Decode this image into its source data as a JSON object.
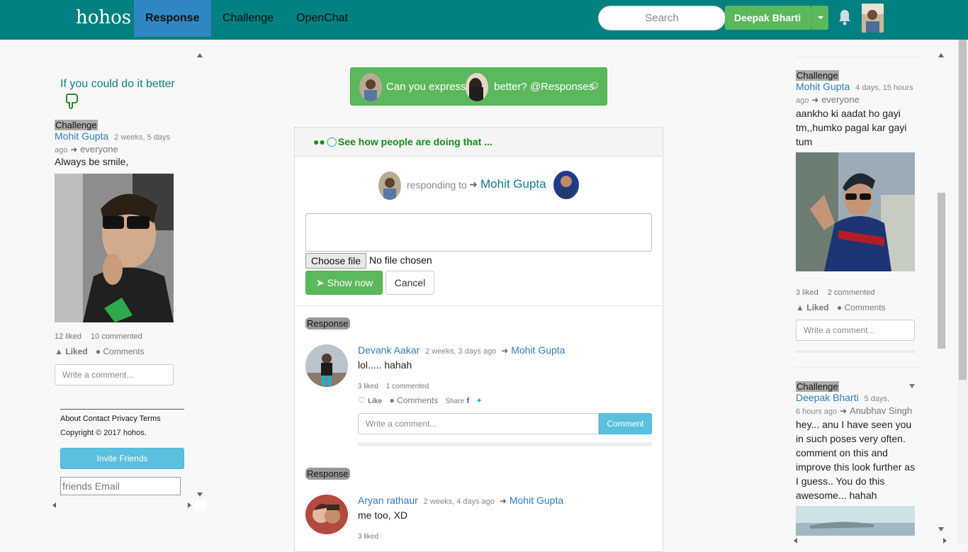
{
  "nav": {
    "brand": "hohos",
    "tabs": [
      "Response",
      "Challenge",
      "OpenChat"
    ],
    "search_placeholder": "Search",
    "user_name": "Deepak Bharti"
  },
  "left": {
    "promo": "If you could do it better",
    "post": {
      "tag": "Challenge",
      "author": "Mohit Gupta",
      "time_line1": "2 weeks, 5 days",
      "time_line2": "ago",
      "audience": "everyone",
      "text": "Always be smile,",
      "liked_count": "12 liked",
      "commented_count": "10 commented",
      "liked_label": "Liked",
      "comments_label": "Comments",
      "comment_placeholder": "Write a comment..."
    },
    "footer_links": "About Contact Privacy Terms",
    "copyright": "Copyright © 2017 hohos.",
    "invite_label": "Invite Friends",
    "email_placeholder": "friends Email"
  },
  "center": {
    "express_before": "Can you express",
    "express_after": "better? @Responses",
    "see_how": "See how people are doing that ...",
    "responding_to": "responding to",
    "responding_name": "Mohit Gupta",
    "file_button": "Choose file",
    "file_status": "No file chosen",
    "show_now": "Show now",
    "cancel": "Cancel",
    "responses": [
      {
        "tag": "Response",
        "author": "Devank Aakar",
        "time": "2 weeks, 3 days ago",
        "target": "Mohit Gupta",
        "text": "lol..... hahah",
        "liked": "3 liked",
        "commented": "1 commented",
        "like_label": "Like",
        "comments_label": "Comments",
        "share_label": "Share",
        "comment_placeholder": "Write a comment...",
        "comment_button": "Comment"
      },
      {
        "tag": "Response",
        "author": "Aryan rathaur",
        "time": "2 weeks, 4 days ago",
        "target": "Mohit Gupta",
        "text": "me too, XD",
        "liked": "3 liked"
      }
    ]
  },
  "right": {
    "posts": [
      {
        "tag": "Challenge",
        "author": "Mohit Gupta",
        "time_line1": "4 days, 15 hours",
        "time_line2": "ago",
        "audience": "everyone",
        "text_lines": [
          "aankho ki aadat ho gayi",
          "tm,,humko pagal kar gayi",
          "tum"
        ],
        "liked": "3 liked",
        "commented": "2 commented",
        "liked_label": "Liked",
        "comments_label": "Comments",
        "comment_placeholder": "Write a comment..."
      },
      {
        "tag": "Challenge",
        "author": "Deepak Bharti",
        "time_line1": "5 days,",
        "time_line2": "6 hours ago",
        "target": "Anubhav Singh",
        "text_lines": [
          "hey... anu I have seen you",
          "in such poses very often.",
          "comment on this and",
          "improve this look further as",
          "I guess.. You do this",
          "awesome... hahah"
        ]
      }
    ]
  },
  "colors": {
    "nav": "#008080",
    "green": "#5cb85c",
    "blue": "#337ab7",
    "teal_link": "#0e7c86",
    "info": "#5bc0de"
  }
}
